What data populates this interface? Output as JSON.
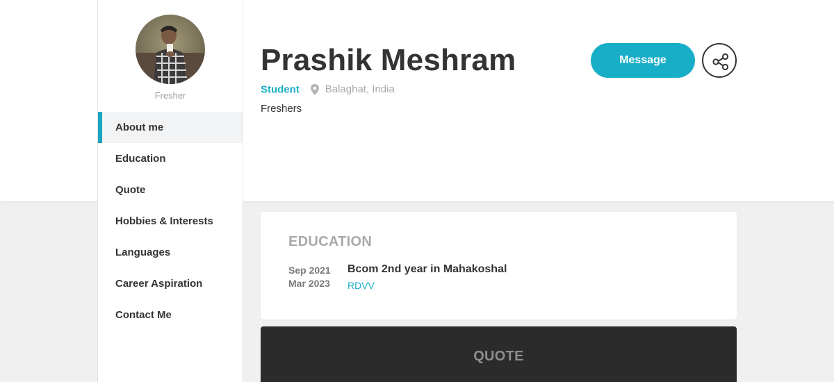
{
  "profile": {
    "avatar_alt": "Profile photo",
    "sidebar_role": "Fresher",
    "name": "Prashik Meshram",
    "role": "Student",
    "location": "Balaghat, India",
    "headline": "Freshers"
  },
  "nav": {
    "items": [
      {
        "label": "About me",
        "active": true
      },
      {
        "label": "Education",
        "active": false
      },
      {
        "label": "Quote",
        "active": false
      },
      {
        "label": "Hobbies & Interests",
        "active": false
      },
      {
        "label": "Languages",
        "active": false
      },
      {
        "label": "Career Aspiration",
        "active": false
      },
      {
        "label": "Contact Me",
        "active": false
      }
    ]
  },
  "actions": {
    "message_label": "Message",
    "share_icon": "share-icon",
    "location_icon": "map-pin-icon"
  },
  "education": {
    "title": "EDUCATION",
    "entries": [
      {
        "start": "Sep 2021",
        "end": "Mar 2023",
        "degree": "Bcom 2nd year in Mahakoshal",
        "school": "RDVV"
      }
    ]
  },
  "quote": {
    "title": "QUOTE"
  },
  "colors": {
    "accent": "#19aec8",
    "text": "#333333",
    "muted": "#a9a9a9",
    "background": "#f0f0f0",
    "dark_card": "#2b2b2c"
  }
}
